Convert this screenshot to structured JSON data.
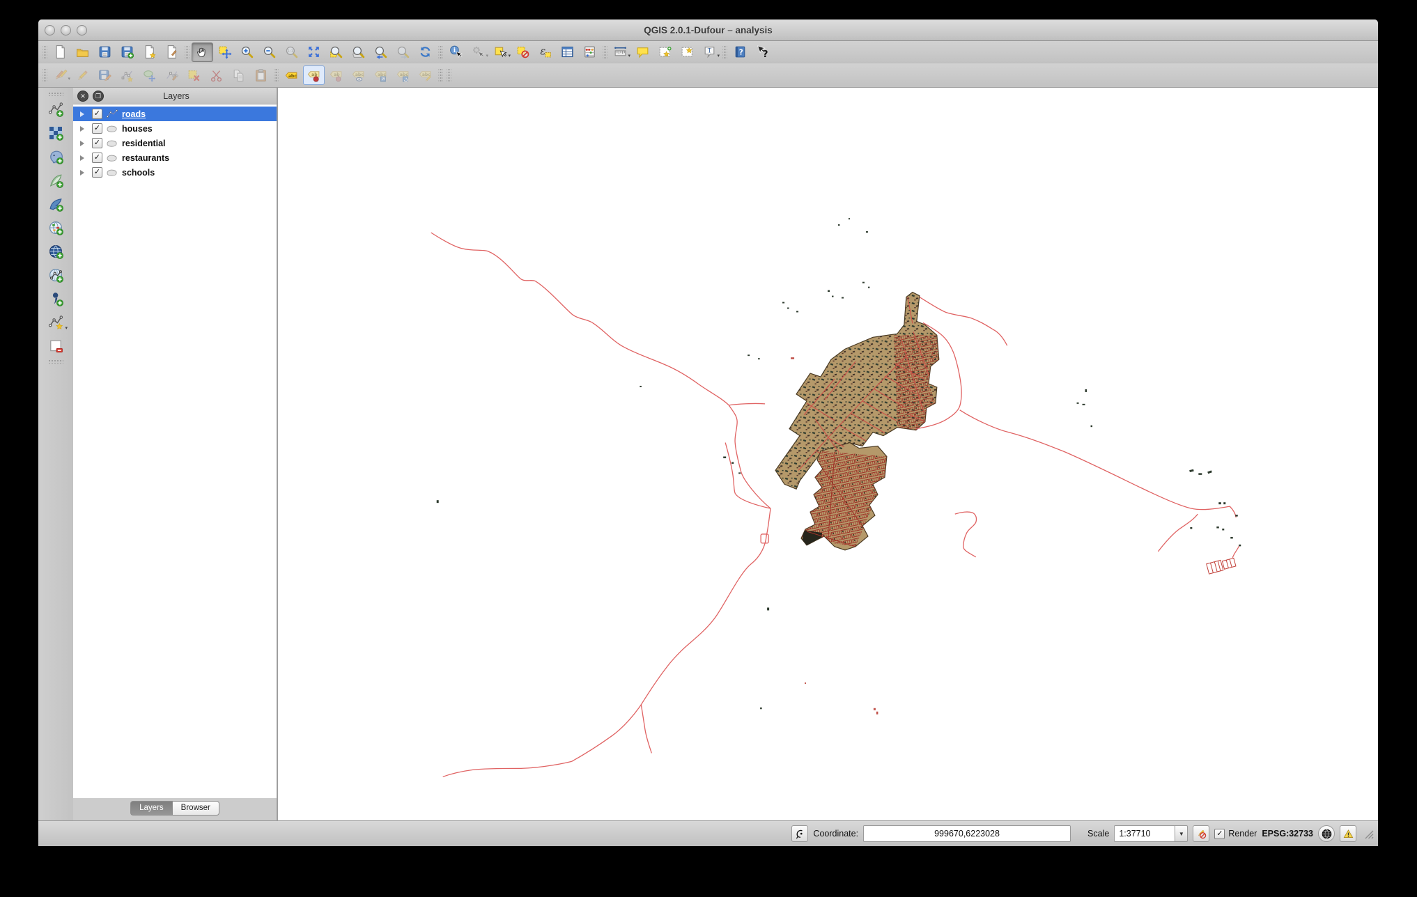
{
  "window": {
    "title": "QGIS 2.0.1-Dufour – analysis"
  },
  "titlebar_buttons": [
    "close-window",
    "minimize-window",
    "zoom-window"
  ],
  "toolbars": {
    "row1": [
      "new-project",
      "open-project",
      "save-project",
      "save-project-as",
      "new-print-composer",
      "composer-manager",
      "pan-map",
      "pan-to-selection",
      "zoom-in",
      "zoom-out",
      "zoom-actual-size",
      "zoom-full",
      "zoom-to-selection",
      "zoom-to-layer",
      "zoom-last",
      "zoom-next",
      "refresh-map",
      "identify-features",
      "run-feature-action",
      "select-features",
      "deselect-features",
      "select-by-expression",
      "open-attribute-table",
      "field-calculator",
      "measure-line",
      "map-tips",
      "new-bookmark",
      "show-bookmarks",
      "text-annotation",
      "help-contents",
      "whats-this"
    ],
    "row2": [
      "current-edits",
      "toggle-editing",
      "save-layer-edits",
      "add-feature",
      "move-feature",
      "node-tool",
      "delete-selected",
      "cut-features",
      "copy-features",
      "paste-features",
      "labeling-options",
      "pin-unpin-labels",
      "highlight-pinned-labels",
      "show-hide-labels",
      "move-label",
      "rotate-label",
      "change-label"
    ],
    "left": [
      "add-vector-layer",
      "add-raster-layer",
      "add-postgis-layer",
      "add-spatialite-layer",
      "add-mssql-layer",
      "add-wms-layer",
      "add-wcs-layer",
      "add-wfs-layer",
      "add-delimited-text-layer",
      "new-shapefile-layer",
      "remove-layer"
    ]
  },
  "layers_panel": {
    "title": "Layers",
    "layers": [
      {
        "name": "roads",
        "checked": true,
        "selected": true,
        "type": "line"
      },
      {
        "name": "houses",
        "checked": true,
        "selected": false,
        "type": "polygon"
      },
      {
        "name": "residential",
        "checked": true,
        "selected": false,
        "type": "polygon"
      },
      {
        "name": "restaurants",
        "checked": true,
        "selected": false,
        "type": "polygon"
      },
      {
        "name": "schools",
        "checked": true,
        "selected": false,
        "type": "polygon"
      }
    ],
    "tabs": [
      {
        "label": "Layers",
        "active": true
      },
      {
        "label": "Browser",
        "active": false
      }
    ]
  },
  "status_bar": {
    "coordinate_label": "Coordinate:",
    "coordinate_value": "999670,6223028",
    "scale_label": "Scale",
    "scale_value": "1:37710",
    "render_label": "Render",
    "render_checked": true,
    "crs": "EPSG:32733"
  },
  "map": {
    "background": "#ffffff",
    "road_color": "#e06363",
    "urban_fill": "#b5996a",
    "urban_stroke": "#4a3a22",
    "building_color": "#2e3b2e",
    "building_color_alt": "#8c2f23"
  },
  "check_glyph": "✓",
  "caret_glyph": "▾"
}
